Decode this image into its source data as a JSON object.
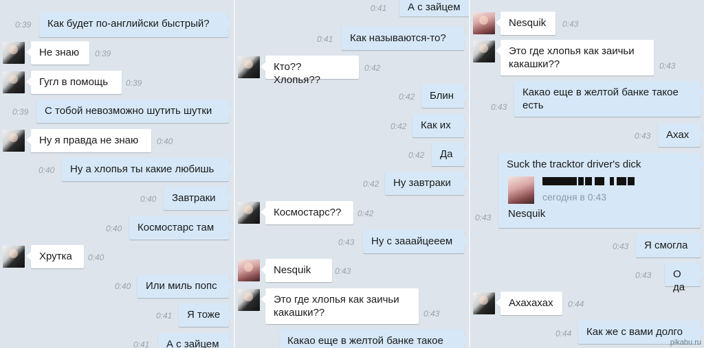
{
  "columns": [
    {
      "messages": [
        {
          "side": "out",
          "text": "Как будет по-английски быстрый?",
          "time": "0:39"
        },
        {
          "side": "in",
          "avatar": "man",
          "text": "Не знаю",
          "time": "0:39"
        },
        {
          "side": "in",
          "avatar": "man",
          "text": "Гугл в помощь",
          "time": "0:39"
        },
        {
          "side": "out",
          "text": "С тобой невозможно шутить шутки",
          "time": "0:39"
        },
        {
          "side": "in",
          "avatar": "man",
          "text": "Ну я правда не знаю",
          "time": "0:40"
        },
        {
          "side": "out",
          "text": "Ну а хлопья ты какие любишь",
          "time": "0:40"
        },
        {
          "side": "out",
          "text": "Завтраки",
          "time": "0:40"
        },
        {
          "side": "out",
          "text": "Космостарс там",
          "time": "0:40"
        },
        {
          "side": "in",
          "avatar": "man",
          "text": "Хрутка",
          "time": "0:40"
        },
        {
          "side": "out",
          "text": "Или миль попс",
          "time": "0:40"
        },
        {
          "side": "out",
          "text": "Я тоже",
          "time": "0:41"
        },
        {
          "side": "out",
          "text": "А с зайцем",
          "time": "0:41"
        }
      ]
    },
    {
      "messages": [
        {
          "side": "out",
          "text": "А с зайцем",
          "time": "0:41"
        },
        {
          "side": "out",
          "text": "Как называются-то?",
          "time": "0:41"
        },
        {
          "side": "in",
          "avatar": "man",
          "text": "Кто?? Хлопья??",
          "time": "0:42"
        },
        {
          "side": "out",
          "text": "Блин",
          "time": "0:42"
        },
        {
          "side": "out",
          "text": "Как их",
          "time": "0:42"
        },
        {
          "side": "out",
          "text": "Да",
          "time": "0:42"
        },
        {
          "side": "out",
          "text": "Ну завтраки",
          "time": "0:42"
        },
        {
          "side": "in",
          "avatar": "man",
          "text": "Космостарс??",
          "time": "0:42"
        },
        {
          "side": "out",
          "text": "Ну с зааайцееем",
          "time": "0:43"
        },
        {
          "side": "in",
          "avatar": "girl",
          "text": "Nesquik",
          "time": "0:43"
        },
        {
          "side": "in",
          "avatar": "man",
          "text": "Это где хлопья как заичьи какашки??",
          "time": "0:43"
        },
        {
          "side": "out",
          "text": "Какао еще в желтой банке такое",
          "time": ""
        }
      ]
    },
    {
      "messages": [
        {
          "side": "in",
          "avatar": "girl",
          "text": "Nesquik",
          "time": "0:43"
        },
        {
          "side": "in",
          "avatar": "man",
          "text": "Это где хлопья как заичьи какашки??",
          "time": "0:43"
        },
        {
          "side": "out",
          "text": "Какао еще в желтой банке такое есть",
          "time": "0:43"
        },
        {
          "side": "out",
          "text": "Ахах",
          "time": "0:43"
        },
        {
          "side": "out",
          "text": "Suck the tracktor driver's dick",
          "time": "0:43",
          "attachment": {
            "date": "сегодня в 0:43",
            "name": "Nesquik"
          }
        },
        {
          "side": "out",
          "text": "Я смогла",
          "time": "0:43"
        },
        {
          "side": "out",
          "text": "О да",
          "time": "0:43"
        },
        {
          "side": "in",
          "avatar": "man",
          "text": "Ахахахах",
          "time": "0:44"
        },
        {
          "side": "out",
          "text": "Как же с вами долго",
          "time": "0:44"
        }
      ]
    }
  ],
  "watermark": "pikabu.ru",
  "colors": {
    "background": "#dde4ec",
    "incoming": "#ffffff",
    "outgoing": "#d6e8f7",
    "time": "#9aa3ad"
  }
}
